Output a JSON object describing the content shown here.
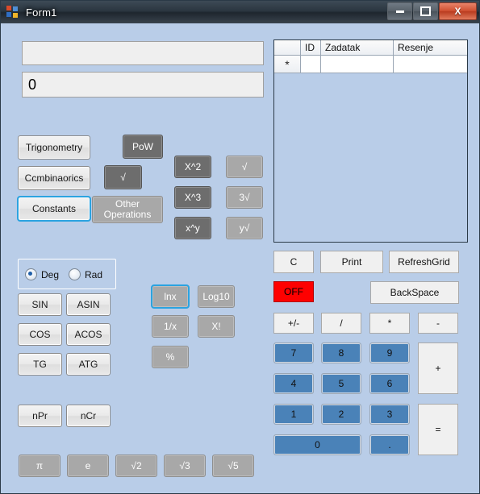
{
  "window": {
    "title": "Form1",
    "icon": "form-app-icon",
    "buttons": {
      "minimize": "minimize-icon",
      "maximize": "maximize-icon",
      "close": "X"
    }
  },
  "display": {
    "expression_value": "",
    "result_value": "0"
  },
  "grid": {
    "columns": [
      "",
      "ID",
      "Zadatak",
      "Resenje"
    ],
    "new_row_marker": "*",
    "row": [
      "*",
      "",
      "",
      ""
    ]
  },
  "category_buttons": [
    {
      "label": "Trigonometry",
      "style": "light"
    },
    {
      "label": "Ccmbinaorics",
      "style": "light"
    },
    {
      "label": "Constants",
      "style": "light-focus"
    },
    {
      "label": "PoW",
      "style": "dark"
    },
    {
      "label": "√",
      "style": "dark"
    },
    {
      "label": "Other Operations",
      "style": "mid"
    }
  ],
  "power_buttons": [
    {
      "label": "X^2",
      "style": "dark"
    },
    {
      "label": "X^3",
      "style": "dark"
    },
    {
      "label": "x^y",
      "style": "dark"
    },
    {
      "label": "√",
      "style": "mid"
    },
    {
      "label": "3√",
      "style": "mid"
    },
    {
      "label": "y√",
      "style": "mid"
    }
  ],
  "angle_mode": {
    "options": [
      "Deg",
      "Rad"
    ],
    "selected": "Deg"
  },
  "trig_buttons": [
    {
      "label": "SIN"
    },
    {
      "label": "ASIN"
    },
    {
      "label": "COS"
    },
    {
      "label": "ACOS"
    },
    {
      "label": "TG"
    },
    {
      "label": "ATG"
    }
  ],
  "log_buttons": [
    {
      "label": "lnx",
      "style": "mid-focus"
    },
    {
      "label": "Log10",
      "style": "mid"
    },
    {
      "label": "1/x",
      "style": "mid"
    },
    {
      "label": "X!",
      "style": "mid"
    },
    {
      "label": "%",
      "style": "mid"
    }
  ],
  "combinatorics_buttons": [
    {
      "label": "nPr"
    },
    {
      "label": "nCr"
    }
  ],
  "constant_buttons": [
    {
      "label": "π"
    },
    {
      "label": "e"
    },
    {
      "label": "√2"
    },
    {
      "label": "√3"
    },
    {
      "label": "√5"
    }
  ],
  "action_buttons": [
    {
      "label": "C",
      "style": "plain"
    },
    {
      "label": "Print",
      "style": "plain"
    },
    {
      "label": "RefreshGrid",
      "style": "plain"
    },
    {
      "label": "OFF",
      "style": "red"
    },
    {
      "label": "BackSpace",
      "style": "plain"
    }
  ],
  "operator_buttons": [
    {
      "label": "+/-",
      "style": "plain"
    },
    {
      "label": "/",
      "style": "plain"
    },
    {
      "label": "*",
      "style": "plain"
    },
    {
      "label": "-",
      "style": "plain"
    },
    {
      "label": "+",
      "style": "plain"
    },
    {
      "label": "=",
      "style": "plain"
    }
  ],
  "number_buttons": [
    {
      "label": "7"
    },
    {
      "label": "8"
    },
    {
      "label": "9"
    },
    {
      "label": "4"
    },
    {
      "label": "5"
    },
    {
      "label": "6"
    },
    {
      "label": "1"
    },
    {
      "label": "2"
    },
    {
      "label": "3"
    },
    {
      "label": "0"
    },
    {
      "label": "."
    }
  ],
  "colors": {
    "form_background": "#b9cde8",
    "number_key": "#4a82b8",
    "dark_button": "#6d6d6d",
    "mid_button": "#a8a8a8",
    "off_button": "#fe0000",
    "focus_outline": "#2ba3e0"
  }
}
